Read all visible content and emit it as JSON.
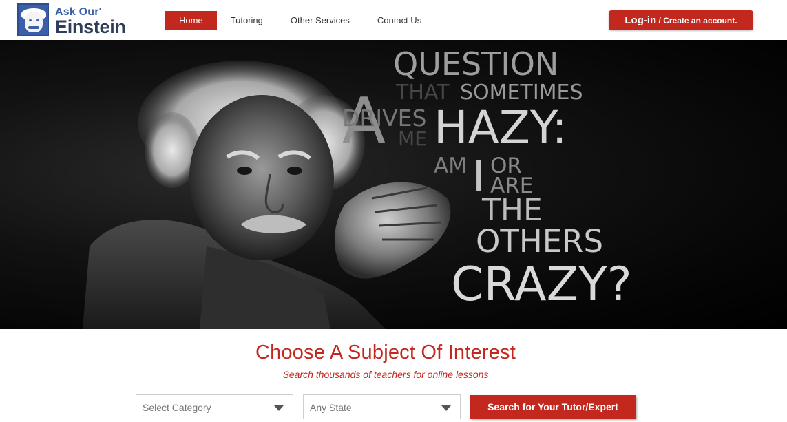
{
  "logo": {
    "line1": "Ask Our'",
    "line2": "Einstein"
  },
  "nav": [
    {
      "label": "Home",
      "active": true
    },
    {
      "label": "Tutoring",
      "active": false
    },
    {
      "label": "Other Services",
      "active": false
    },
    {
      "label": "Contact Us",
      "active": false
    }
  ],
  "login": {
    "main": "Log-in",
    "secondary": " / Create an account."
  },
  "hero": {
    "quote": {
      "a": "A",
      "question": "QUESTION",
      "that": "THAT",
      "sometimes": "SOMETIMES",
      "drives": "DRIVES",
      "me": "ME",
      "hazy": "HAZY:",
      "am": "AM",
      "i": "I",
      "or": "OR",
      "are": "ARE",
      "the": "THE",
      "others": "OTHERS",
      "crazy": "CRAZY?"
    }
  },
  "search": {
    "title": "Choose A Subject Of Interest",
    "subtitle": "Search thousands of teachers for online lessons",
    "category_placeholder": "Select Category",
    "state_placeholder": "Any State",
    "button_label": "Search for Your Tutor/Expert"
  },
  "colors": {
    "accent": "#c3281e",
    "brand_blue": "#3a5fa8"
  }
}
